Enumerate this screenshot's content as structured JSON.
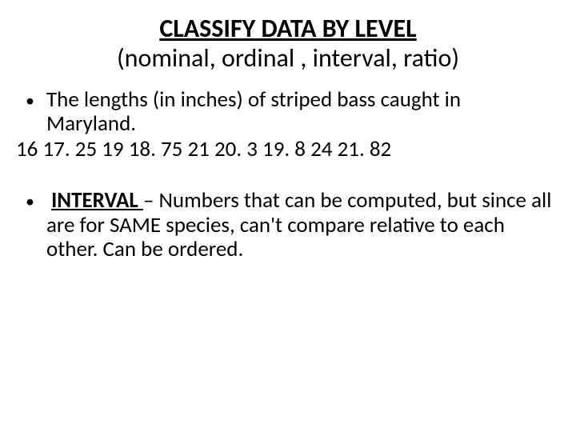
{
  "title": {
    "line1": "CLASSIFY DATA BY LEVEL",
    "line2": "(nominal, ordinal , interval, ratio)"
  },
  "bullet1": {
    "text": "The lengths (in inches) of  striped bass caught in Maryland."
  },
  "data_values": "16   17. 25   19   18. 75   21   20. 3   19. 8   24   21. 82",
  "bullet2": {
    "label": "INTERVAL ",
    "rest": "– Numbers that can be computed, but since all are for SAME species, can't compare relative to each other. Can be ordered."
  }
}
